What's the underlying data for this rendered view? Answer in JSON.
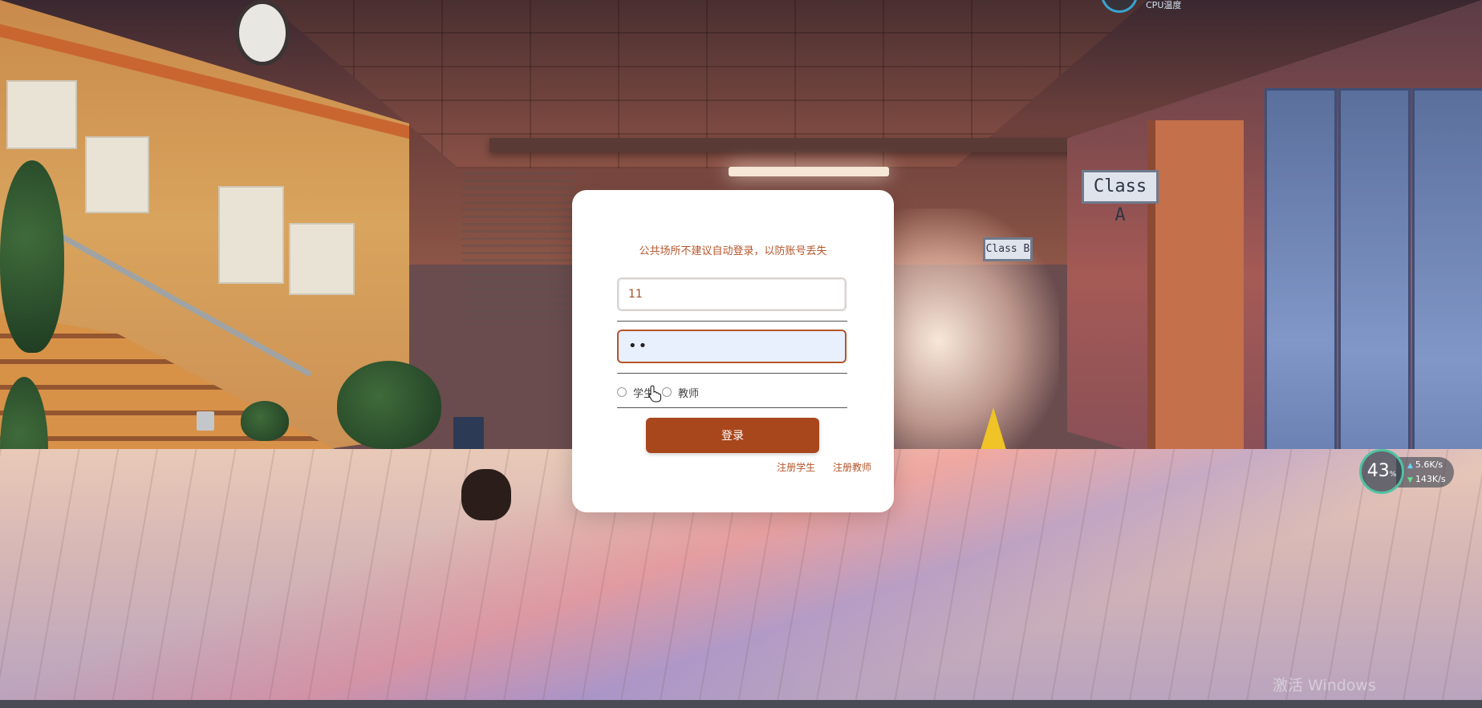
{
  "login": {
    "notice": "公共场所不建议自动登录，以防账号丢失",
    "username_value": "11",
    "password_value": "••",
    "roles": [
      {
        "label": "学生",
        "checked": false
      },
      {
        "label": "教师",
        "checked": false
      }
    ],
    "login_button": "登录",
    "register_student": "注册学生",
    "register_teacher": "注册教师"
  },
  "speed_widget": {
    "percent": "43",
    "percent_unit": "%",
    "upload": "5.6K/s",
    "download": "143K/s"
  },
  "cpu_badge": {
    "label": "CPU温度"
  },
  "scene_signs": {
    "class_a": "Class A",
    "class_b": "Class B"
  },
  "watermark": "激活 Windows",
  "colors": {
    "accent": "#a8461c",
    "notice_text": "#b5552a",
    "password_fill": "#e8f0fd"
  }
}
